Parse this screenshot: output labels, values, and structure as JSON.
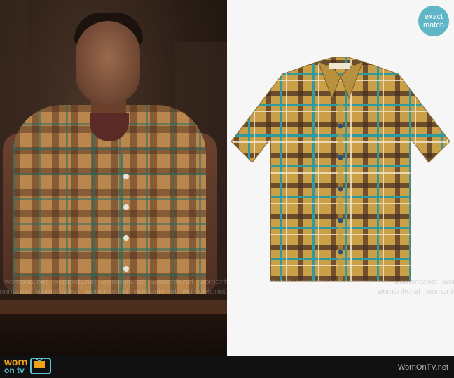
{
  "badge": {
    "line1": "exact",
    "line2": "match"
  },
  "watermark": {
    "text": "womontv.net",
    "repeat_count": 16
  },
  "footer": {
    "logo_worn": "worn",
    "logo_ontv": "on tv",
    "site_name": "WornOnTV.net"
  },
  "colors": {
    "badge_bg": "#5fb6c6",
    "logo_orange": "#f0a11b",
    "logo_teal": "#5cc0cf",
    "shirt_mustard": "#c9a047",
    "plaid_teal": "#2f9aa0",
    "plaid_brown": "#4a2e22"
  },
  "icons": {
    "tv": "tv-icon"
  }
}
